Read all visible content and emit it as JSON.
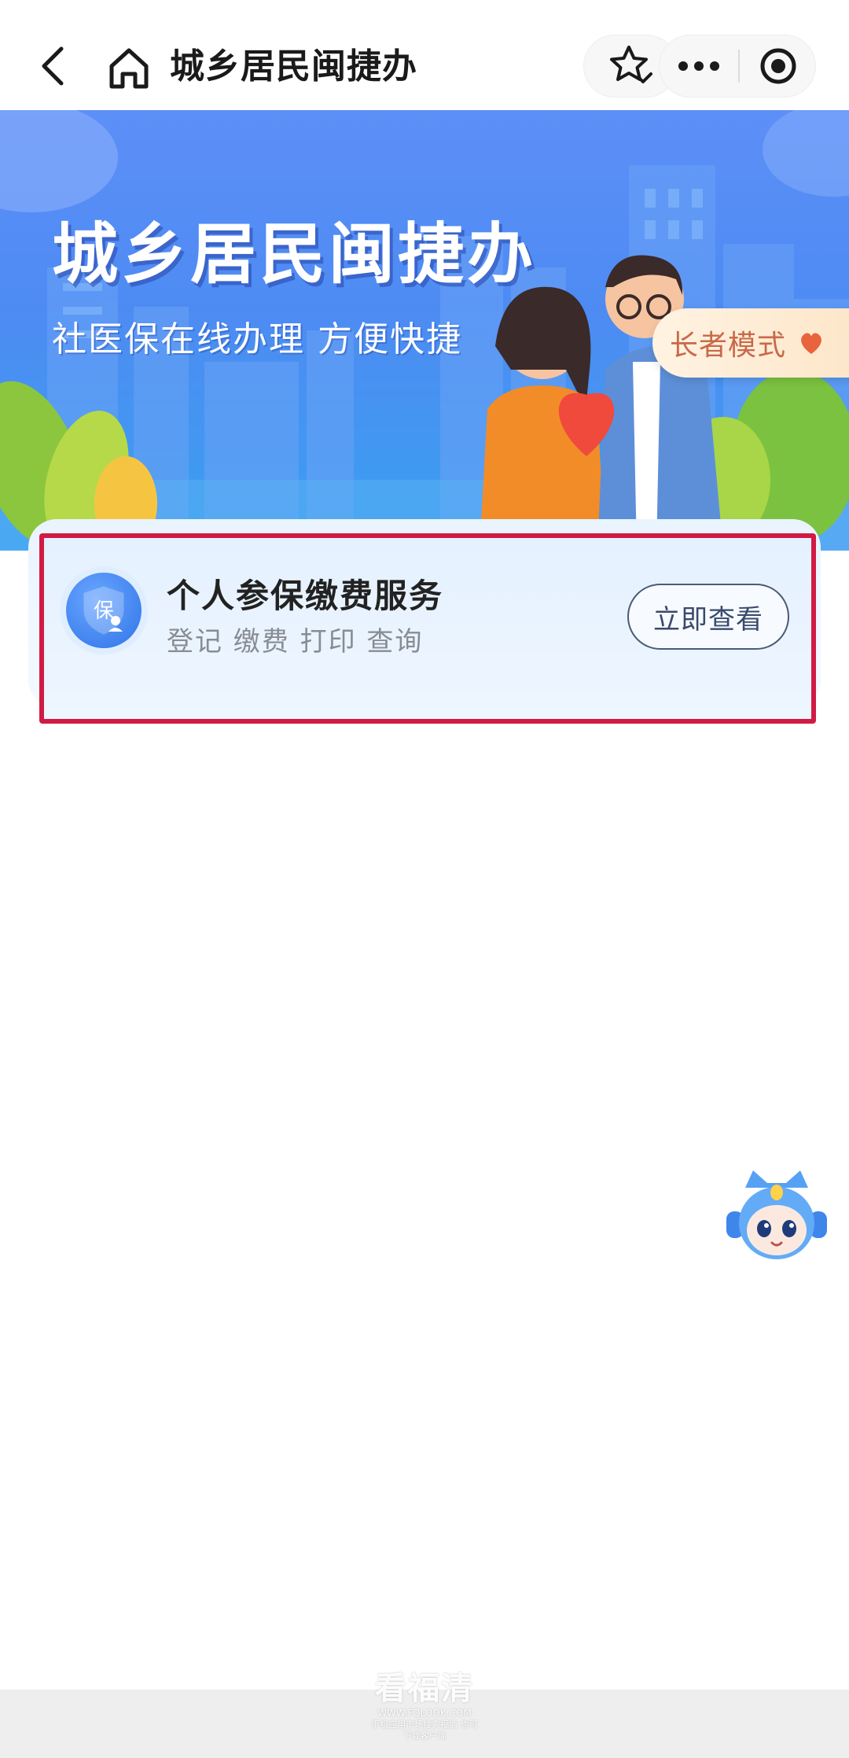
{
  "navbar": {
    "title": "城乡居民闽捷办",
    "back_icon": "chevron-left-icon",
    "home_icon": "home-icon",
    "favorite_icon": "star-add-icon",
    "more_icon": "more-dots-icon",
    "close_icon": "target-circle-icon"
  },
  "banner": {
    "title": "城乡居民闽捷办",
    "subtitle": "社医保在线办理 方便快捷",
    "elder_mode_label": "长者模式",
    "elder_mode_icon": "heart-icon",
    "accent": "#4d8bf3"
  },
  "service_card": {
    "icon": "insurance-shield-icon",
    "icon_text": "保",
    "title": "个人参保缴费服务",
    "subtitle": "登记 缴费 打印 查询",
    "button_label": "立即查看",
    "highlight_color": "#d11b44"
  },
  "assistant": {
    "icon": "robot-assistant-icon"
  },
  "watermark": {
    "main": "看福清",
    "url": "WWW.FQLOOK.COM",
    "tip": "手机应用市场搜索福清 你可下载客户端"
  }
}
